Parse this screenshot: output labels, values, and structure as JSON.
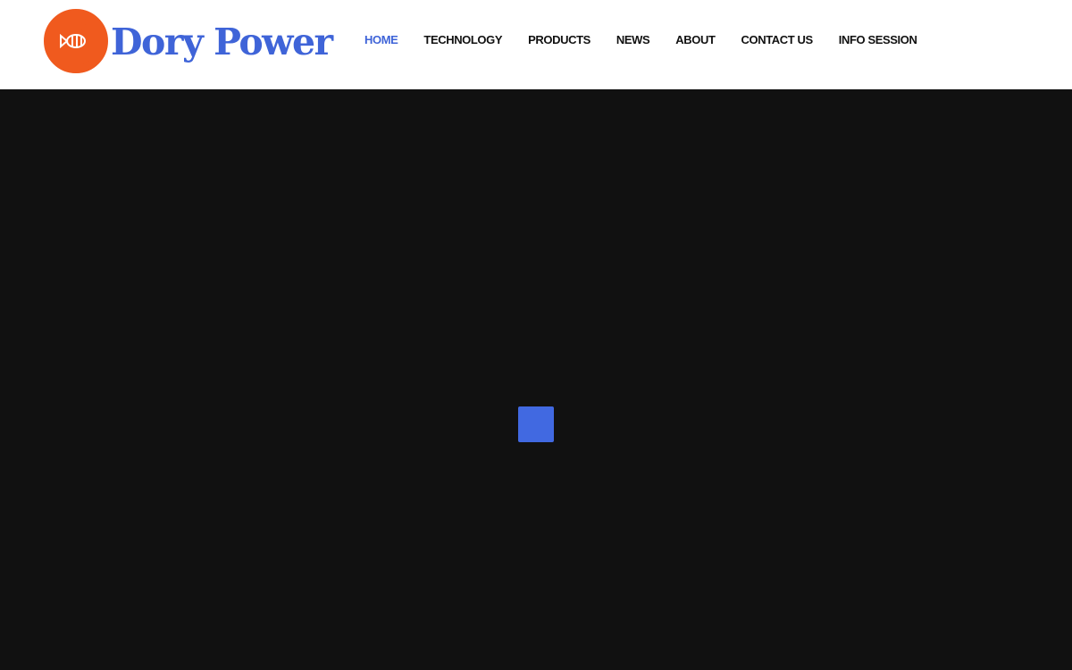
{
  "brand": {
    "name": "Dory Power",
    "color": "#3f64d8",
    "mark_color": "#f05a1e",
    "mark_icon": "spiral-fish-logo-icon"
  },
  "nav": {
    "items": [
      {
        "label": "HOME",
        "active": true
      },
      {
        "label": "TECHNOLOGY",
        "active": false
      },
      {
        "label": "PRODUCTS",
        "active": false
      },
      {
        "label": "NEWS",
        "active": false
      },
      {
        "label": "ABOUT",
        "active": false
      },
      {
        "label": "CONTACT US",
        "active": false
      },
      {
        "label": "INFO SESSION",
        "active": false
      }
    ],
    "active_color": "#3f64d8",
    "text_color": "#111111"
  },
  "hero": {
    "background_color": "#111111",
    "loader_icon": "loading-spinner-icon",
    "loader_color": "#4169e1"
  }
}
